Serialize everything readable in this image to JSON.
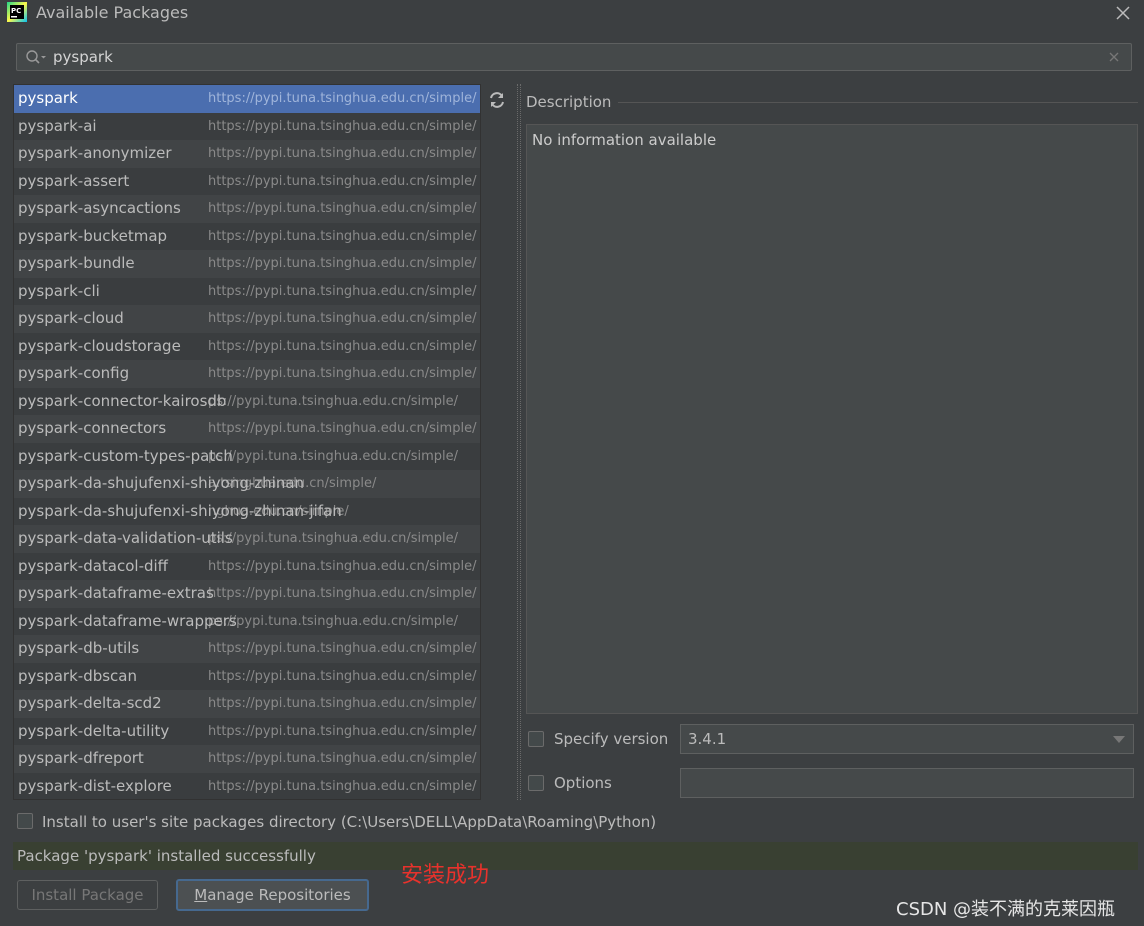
{
  "window": {
    "title": "Available Packages",
    "icon": "pycharm-icon",
    "icon_text": "PC"
  },
  "search": {
    "value": "pyspark",
    "placeholder": ""
  },
  "packages": [
    {
      "name": "pyspark",
      "repo": "https://pypi.tuna.tsinghua.edu.cn/simple/",
      "selected": true
    },
    {
      "name": "pyspark-ai",
      "repo": "https://pypi.tuna.tsinghua.edu.cn/simple/"
    },
    {
      "name": "pyspark-anonymizer",
      "repo": "https://pypi.tuna.tsinghua.edu.cn/simple/"
    },
    {
      "name": "pyspark-assert",
      "repo": "https://pypi.tuna.tsinghua.edu.cn/simple/"
    },
    {
      "name": "pyspark-asyncactions",
      "repo": "https://pypi.tuna.tsinghua.edu.cn/simple/"
    },
    {
      "name": "pyspark-bucketmap",
      "repo": "https://pypi.tuna.tsinghua.edu.cn/simple/"
    },
    {
      "name": "pyspark-bundle",
      "repo": "https://pypi.tuna.tsinghua.edu.cn/simple/"
    },
    {
      "name": "pyspark-cli",
      "repo": "https://pypi.tuna.tsinghua.edu.cn/simple/"
    },
    {
      "name": "pyspark-cloud",
      "repo": "https://pypi.tuna.tsinghua.edu.cn/simple/"
    },
    {
      "name": "pyspark-cloudstorage",
      "repo": "https://pypi.tuna.tsinghua.edu.cn/simple/"
    },
    {
      "name": "pyspark-config",
      "repo": "https://pypi.tuna.tsinghua.edu.cn/simple/"
    },
    {
      "name": "pyspark-connector-kairosdb",
      "repo": "ps://pypi.tuna.tsinghua.edu.cn/simple/"
    },
    {
      "name": "pyspark-connectors",
      "repo": "https://pypi.tuna.tsinghua.edu.cn/simple/"
    },
    {
      "name": "pyspark-custom-types-patch",
      "repo": "ps://pypi.tuna.tsinghua.edu.cn/simple/"
    },
    {
      "name": "pyspark-da-shujufenxi-shiyong-zhinan",
      "repo": "a.tsinghua.edu.cn/simple/"
    },
    {
      "name": "pyspark-da-shujufenxi-shiyong-zhinan-jifan",
      "repo": "nghua.edu.cn/simple/"
    },
    {
      "name": "pyspark-data-validation-utils",
      "repo": "ps://pypi.tuna.tsinghua.edu.cn/simple/"
    },
    {
      "name": "pyspark-datacol-diff",
      "repo": "https://pypi.tuna.tsinghua.edu.cn/simple/"
    },
    {
      "name": "pyspark-dataframe-extras",
      "repo": "https://pypi.tuna.tsinghua.edu.cn/simple/"
    },
    {
      "name": "pyspark-dataframe-wrappers",
      "repo": "ps://pypi.tuna.tsinghua.edu.cn/simple/"
    },
    {
      "name": "pyspark-db-utils",
      "repo": "https://pypi.tuna.tsinghua.edu.cn/simple/"
    },
    {
      "name": "pyspark-dbscan",
      "repo": "https://pypi.tuna.tsinghua.edu.cn/simple/"
    },
    {
      "name": "pyspark-delta-scd2",
      "repo": "https://pypi.tuna.tsinghua.edu.cn/simple/"
    },
    {
      "name": "pyspark-delta-utility",
      "repo": "https://pypi.tuna.tsinghua.edu.cn/simple/"
    },
    {
      "name": "pyspark-dfreport",
      "repo": "https://pypi.tuna.tsinghua.edu.cn/simple/"
    },
    {
      "name": "pyspark-dist-explore",
      "repo": "https://pypi.tuna.tsinghua.edu.cn/simple/"
    }
  ],
  "description": {
    "label": "Description",
    "text": "No information available"
  },
  "specify_version": {
    "label": "Specify version",
    "checked": false,
    "value": "3.4.1"
  },
  "options": {
    "label": "Options",
    "checked": false,
    "value": ""
  },
  "install_user_site": {
    "label": "Install to user's site packages directory (C:\\Users\\DELL\\AppData\\Roaming\\Python)",
    "checked": false
  },
  "status": {
    "message": "Package 'pyspark' installed successfully"
  },
  "buttons": {
    "install": "Install Package",
    "manage_first": "M",
    "manage_rest": "anage Repositories"
  },
  "annotation": {
    "text": "安装成功",
    "color": "#e8322c"
  },
  "watermark": {
    "text": "CSDN @装不满的克莱因瓶"
  },
  "colors": {
    "background": "#3c3f41",
    "selection": "#4b6eaf",
    "status_bg": "#394032"
  }
}
